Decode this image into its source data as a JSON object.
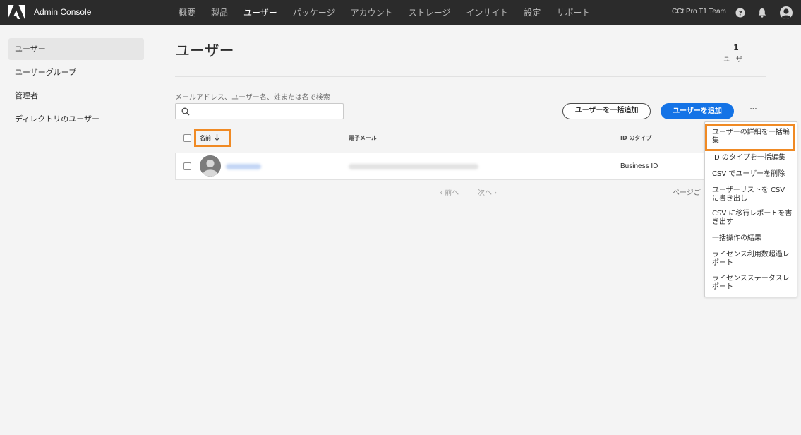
{
  "app": {
    "name": "Admin Console",
    "org": "CCt Pro T1 Team"
  },
  "nav": {
    "items": [
      "概要",
      "製品",
      "ユーザー",
      "パッケージ",
      "アカウント",
      "ストレージ",
      "インサイト",
      "設定",
      "サポート"
    ],
    "active_index": 2
  },
  "sidebar": {
    "items": [
      "ユーザー",
      "ユーザーグループ",
      "管理者",
      "ディレクトリのユーザー"
    ],
    "active_index": 0
  },
  "main": {
    "title": "ユーザー",
    "count": "1",
    "count_label": "ユーザー",
    "search_label": "メールアドレス、ユーザー名、姓または名で検索",
    "search_value": "",
    "bulk_add_label": "ユーザーを一括追加",
    "add_user_label": "ユーザーを追加",
    "more_label": "···"
  },
  "table": {
    "columns": {
      "name": "名前",
      "email": "電子メール",
      "id_type": "ID のタイプ"
    },
    "sort_icon": "arrow-down-icon",
    "rows": [
      {
        "id_type": "Business ID"
      }
    ]
  },
  "pagination": {
    "prev": "前へ",
    "next": "次へ",
    "per_page": "ページご"
  },
  "menu": {
    "items": [
      "ユーザーの詳細を一括編集",
      "ID のタイプを一括編集",
      "CSV でユーザーを削除",
      "ユーザーリストを CSV に書き出し",
      "CSV に移行レポートを書き出す",
      "一括操作の結果",
      "ライセンス利用数超過レポート",
      "ライセンスステータスレポート"
    ]
  },
  "colors": {
    "topbar": "#2b2b2b",
    "accent": "#1473e6",
    "highlight": "#f08a24",
    "background": "#f4f4f4"
  }
}
